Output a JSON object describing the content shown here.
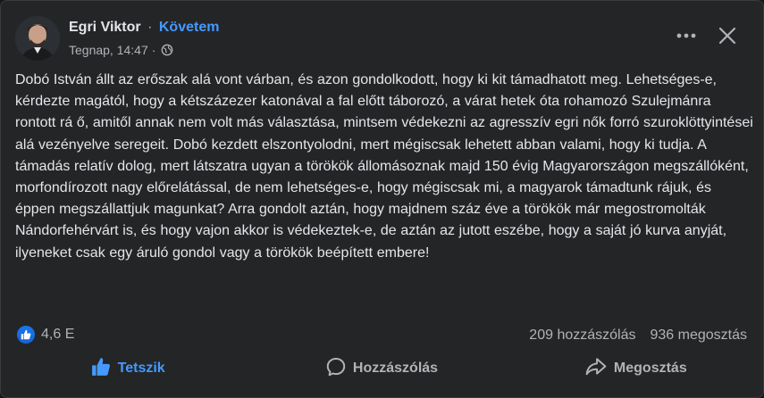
{
  "post": {
    "author": "Egri Viktor",
    "separator": "·",
    "follow_label": "Követem",
    "timestamp": "Tegnap, 14:47",
    "meta_separator": "·",
    "privacy_icon": "globe-icon",
    "text": "Dobó István állt az erőszak alá vont várban, és azon gondolkodott, hogy ki kit támadhatott meg. Lehetséges-e, kérdezte magától, hogy a kétszázezer katonával a fal előtt táborozó, a várat hetek óta rohamozó Szulejmánra rontott rá ő, amitől annak nem volt más választása, mintsem védekezni az agresszív egri nők forró szuroklöttyintései alá vezényelve seregeit. Dobó kezdett elszontyolodni, mert mégiscsak lehetett abban valami, hogy ki tudja. A támadás relatív dolog, mert látszatra ugyan a törökök állomásoznak majd 150 évig Magyarországon megszállóként, morfondírozott nagy előrelátással, de nem lehetséges-e, hogy mégiscsak mi, a magyarok támadtunk rájuk, és éppen megszállattjuk magunkat? Arra gondolt aztán, hogy majdnem száz éve a törökök már megostromolták Nándorfehérvárt is, és hogy vajon akkor is védekeztek-e, de aztán az jutott eszébe, hogy a saját jó kurva anyját, ilyeneket csak egy áruló gondol vagy a törökök beépített embere!"
  },
  "engagement": {
    "reaction_icon": "like-icon",
    "reaction_count": "4,6 E",
    "comments": "209 hozzászólás",
    "shares": "936 megosztás"
  },
  "actions": {
    "like_label": "Tetszik",
    "comment_label": "Hozzászólás",
    "share_label": "Megosztás"
  },
  "colors": {
    "background": "#242526",
    "text": "#e4e6eb",
    "secondary_text": "#b0b3b8",
    "accent": "#4599ff"
  }
}
